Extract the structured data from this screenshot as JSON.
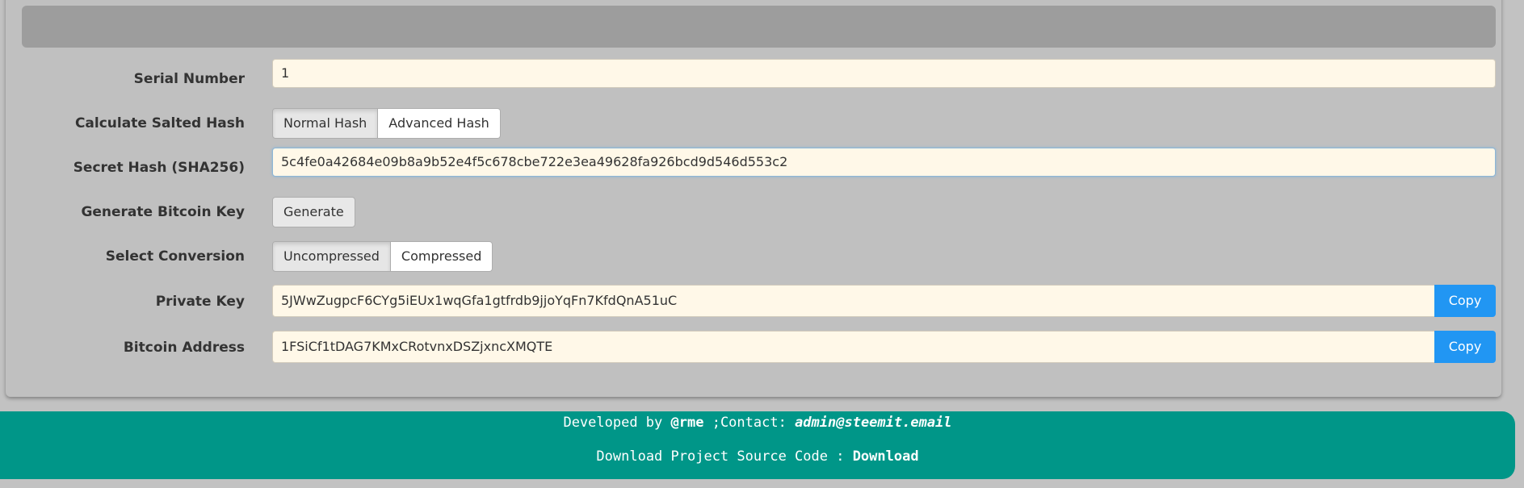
{
  "form": {
    "serial_label": "Serial Number",
    "serial_value": "1",
    "salted_label": "Calculate Salted Hash",
    "normal_hash": "Normal Hash",
    "advanced_hash": "Advanced Hash",
    "secret_label": "Secret Hash (SHA256)",
    "secret_value": "5c4fe0a42684e09b8a9b52e4f5c678cbe722e3ea49628fa926bcd9d546d553c2",
    "generate_label": "Generate Bitcoin Key",
    "generate_button": "Generate",
    "conversion_label": "Select Conversion",
    "uncompressed": "Uncompressed",
    "compressed": "Compressed",
    "private_key_label": "Private Key",
    "private_key_value": "5JWwZugpcF6CYg5iEUx1wqGfa1gtfrdb9jjoYqFn7KfdQnA51uC",
    "address_label": "Bitcoin Address",
    "address_value": "1FSiCf1tDAG7KMxCRotvnxDSZjxncXMQTE",
    "copy_label": "Copy"
  },
  "footer": {
    "developed_prefix": "Developed by ",
    "developer": "@rme",
    "contact_prefix": " ;Contact: ",
    "email": "admin@steemit.email",
    "download_prefix": "Download Project Source Code : ",
    "download_link": "Download"
  },
  "colors": {
    "background": "#c2c2c2",
    "input_bg": "#fff8e8",
    "copy_button": "#2196f3",
    "footer": "#009688"
  }
}
